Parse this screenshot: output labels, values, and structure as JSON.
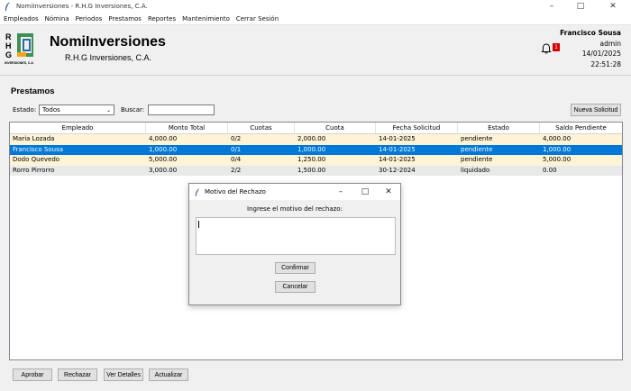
{
  "window": {
    "title": "NomiInversiones - R.H.G Inversiones, C.A."
  },
  "menu": [
    "Empleados",
    "Nómina",
    "Periodos",
    "Prestamos",
    "Reportes",
    "Mantenimiento",
    "Cerrar Sesión"
  ],
  "brand": {
    "name": "NomiInversiones",
    "subtitle": "R.H.G Inversiones, C.A.",
    "logo_letters": [
      "R",
      "H",
      "G"
    ],
    "logo_caption": "INVERSIONES, C.A"
  },
  "notifications": {
    "count": "1"
  },
  "user": {
    "name": "Francisco Sousa",
    "role": "admin",
    "date": "14/01/2025",
    "time": "22:51:28"
  },
  "section": {
    "title": "Prestamos"
  },
  "filters": {
    "estado_label": "Estado:",
    "estado_value": "Todos",
    "buscar_label": "Buscar:",
    "buscar_value": ""
  },
  "buttons": {
    "new_request": "Nueva Solicitud",
    "approve": "Aprobar",
    "reject": "Rechazar",
    "details": "Ver Detalles",
    "refresh": "Actualizar"
  },
  "table": {
    "columns": [
      "Empleado",
      "Monto Total",
      "Cuotas",
      "Cuota",
      "Fecha Solicitud",
      "Estado",
      "Saldo Pendiente"
    ],
    "rows": [
      [
        "Maria Lozada",
        "4,000.00",
        "0/2",
        "2,000.00",
        "14-01-2025",
        "pendiente",
        "4,000.00"
      ],
      [
        "Francisco Sousa",
        "1,000.00",
        "0/1",
        "1,000.00",
        "14-01-2025",
        "pendiente",
        "1,000.00"
      ],
      [
        "Dodo Quevedo",
        "5,000.00",
        "0/4",
        "1,250.00",
        "14-01-2025",
        "pendiente",
        "5,000.00"
      ],
      [
        "Rorro Pirrorro",
        "3,000.00",
        "2/2",
        "1,500.00",
        "30-12-2024",
        "liquidado",
        "0.00"
      ]
    ],
    "selected_row": 1
  },
  "dialog": {
    "title": "Motivo del Rechazo",
    "prompt": "Ingrese el motivo del rechazo:",
    "text": "",
    "confirm": "Confirmar",
    "cancel": "Cancelar"
  },
  "colors": {
    "selection": "#0078d7",
    "pending_row": "#fdf3d6",
    "liquidated_row": "#e9e9e9",
    "badge": "#d60000"
  }
}
